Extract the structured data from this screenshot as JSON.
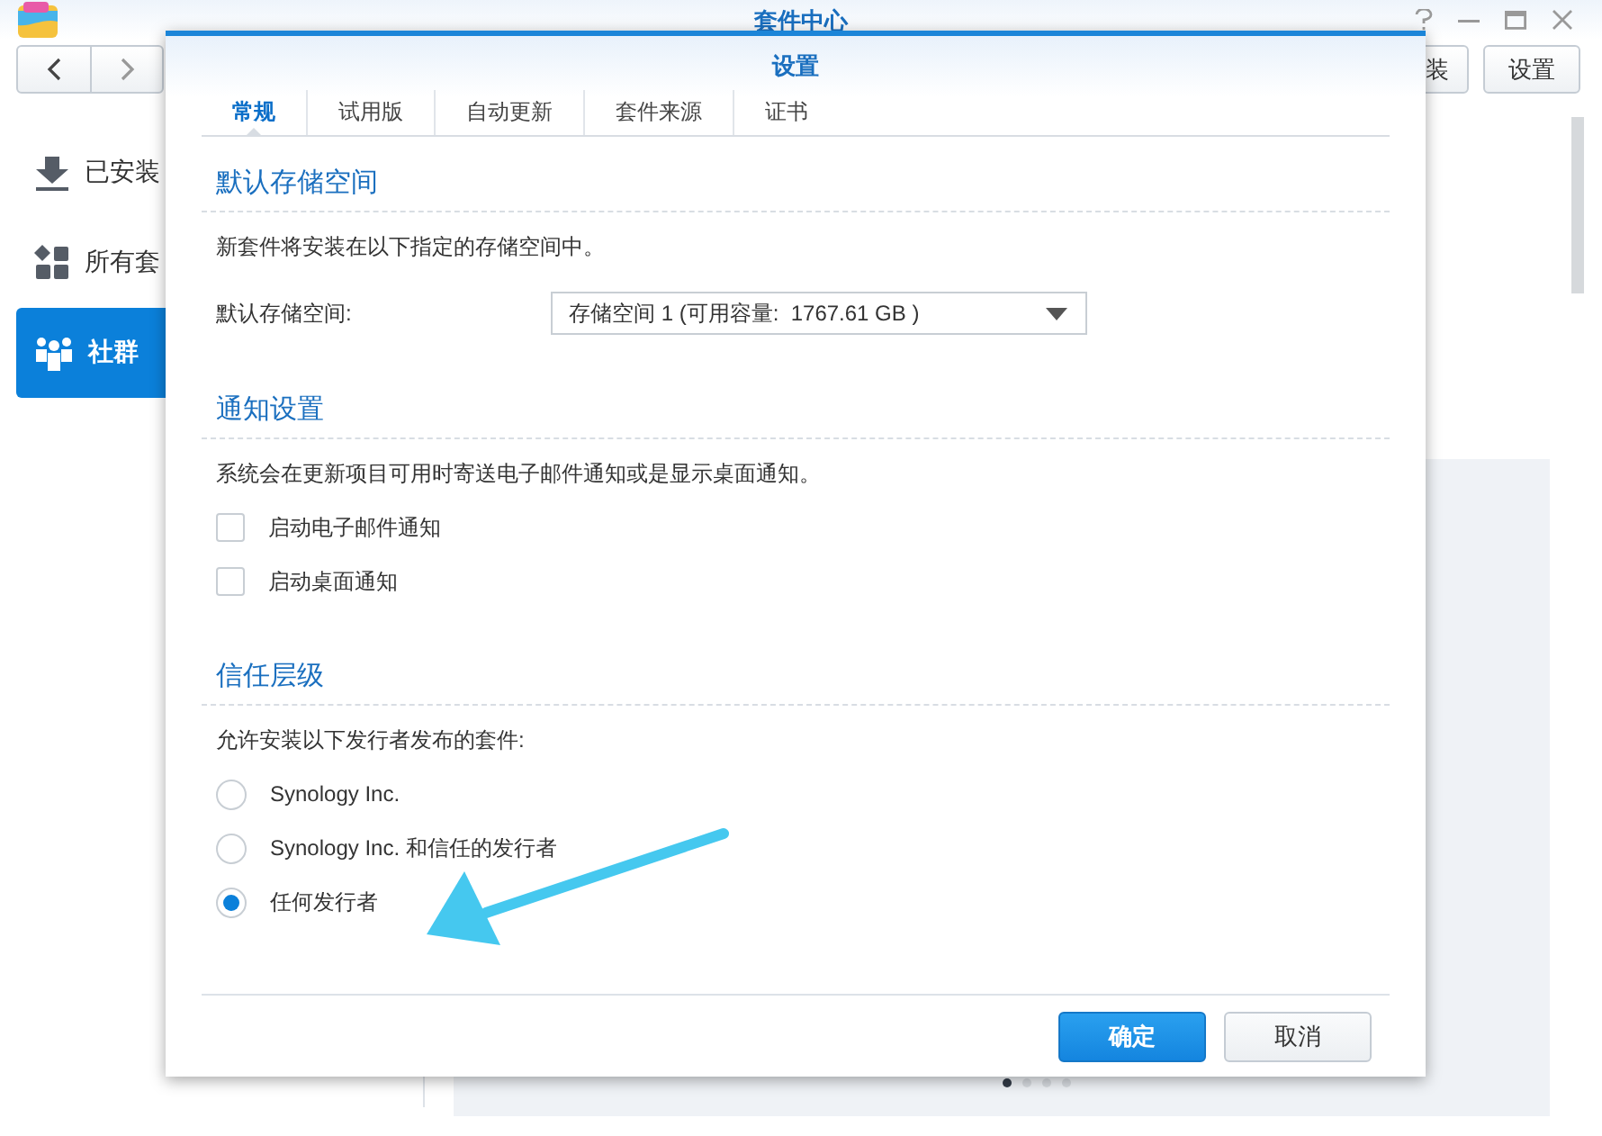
{
  "window": {
    "title": "套件中心"
  },
  "toolbar": {
    "buttons": [
      "装",
      "设置"
    ]
  },
  "sidebar": {
    "items": [
      {
        "label": "已安装",
        "selected": false
      },
      {
        "label": "所有套",
        "selected": false
      },
      {
        "label": "社群",
        "selected": true
      }
    ]
  },
  "pagination": {
    "dots": [
      {
        "selected": true
      },
      {
        "selected": false
      },
      {
        "selected": false
      },
      {
        "selected": false
      }
    ]
  },
  "dialog": {
    "title": "设置",
    "tabs": [
      {
        "label": "常规",
        "selected": true
      },
      {
        "label": "试用版",
        "selected": false
      },
      {
        "label": "自动更新",
        "selected": false
      },
      {
        "label": "套件来源",
        "selected": false
      },
      {
        "label": "证书",
        "selected": false
      }
    ],
    "sections": [
      {
        "title": "默认存储空间",
        "description": "新套件将安装在以下指定的存储空间中。",
        "controls": [
          {
            "kind": "select",
            "label": "默认存储空间:",
            "value": "存储空间 1 (可用容量:  1767.61 GB )"
          }
        ]
      },
      {
        "title": "通知设置",
        "description": "系统会在更新项目可用时寄送电子邮件通知或是显示桌面通知。",
        "controls": [
          {
            "kind": "checkbox",
            "label": "启动电子邮件通知",
            "checked": false
          },
          {
            "kind": "checkbox",
            "label": "启动桌面通知",
            "checked": false
          }
        ]
      },
      {
        "title": "信任层级",
        "description": "允许安装以下发行者发布的套件:",
        "controls": [
          {
            "kind": "radio",
            "label": "Synology Inc.",
            "selected": false
          },
          {
            "kind": "radio",
            "label": "Synology Inc. 和信任的发行者",
            "selected": false
          },
          {
            "kind": "radio",
            "label": "任何发行者",
            "selected": true
          }
        ]
      }
    ],
    "buttons": [
      {
        "label": "确定",
        "kind": "primary"
      },
      {
        "label": "取消",
        "kind": "default"
      }
    ]
  }
}
